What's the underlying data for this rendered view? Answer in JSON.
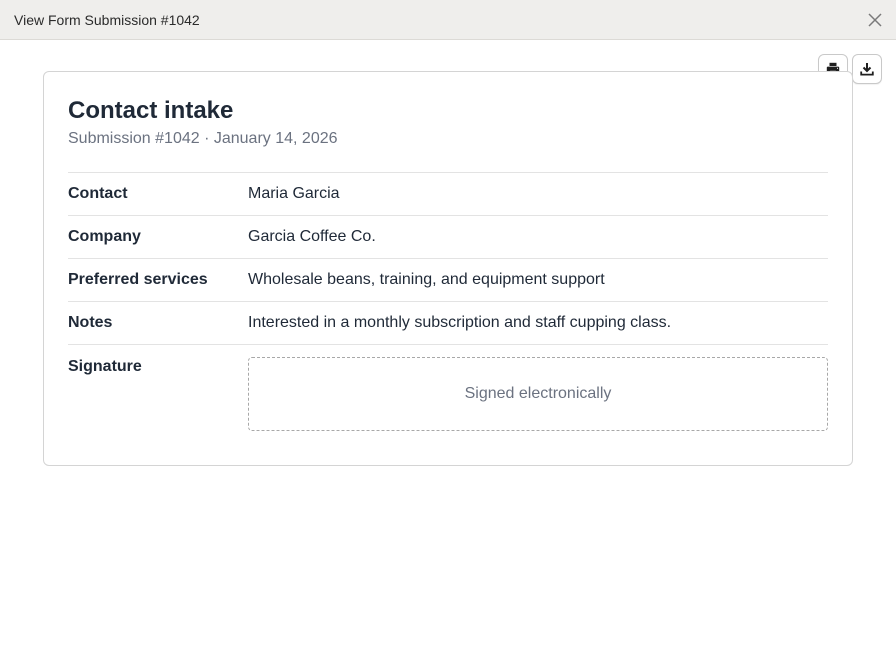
{
  "window": {
    "title": "View Form Submission #1042",
    "close_icon": "close-icon"
  },
  "actions": {
    "print_icon": "printer-icon",
    "download_icon": "download-icon"
  },
  "form": {
    "title": "Contact intake",
    "subtitle": "Submission #1042 · January 14, 2026",
    "fields": [
      {
        "label": "Contact",
        "value": "Maria Garcia"
      },
      {
        "label": "Company",
        "value": "Garcia Coffee Co."
      },
      {
        "label": "Preferred services",
        "value": "Wholesale beans, training, and equipment support"
      },
      {
        "label": "Notes",
        "value": "Interested in a monthly subscription and staff cupping class."
      }
    ],
    "signature": {
      "label": "Signature",
      "status": "Signed electronically"
    }
  }
}
